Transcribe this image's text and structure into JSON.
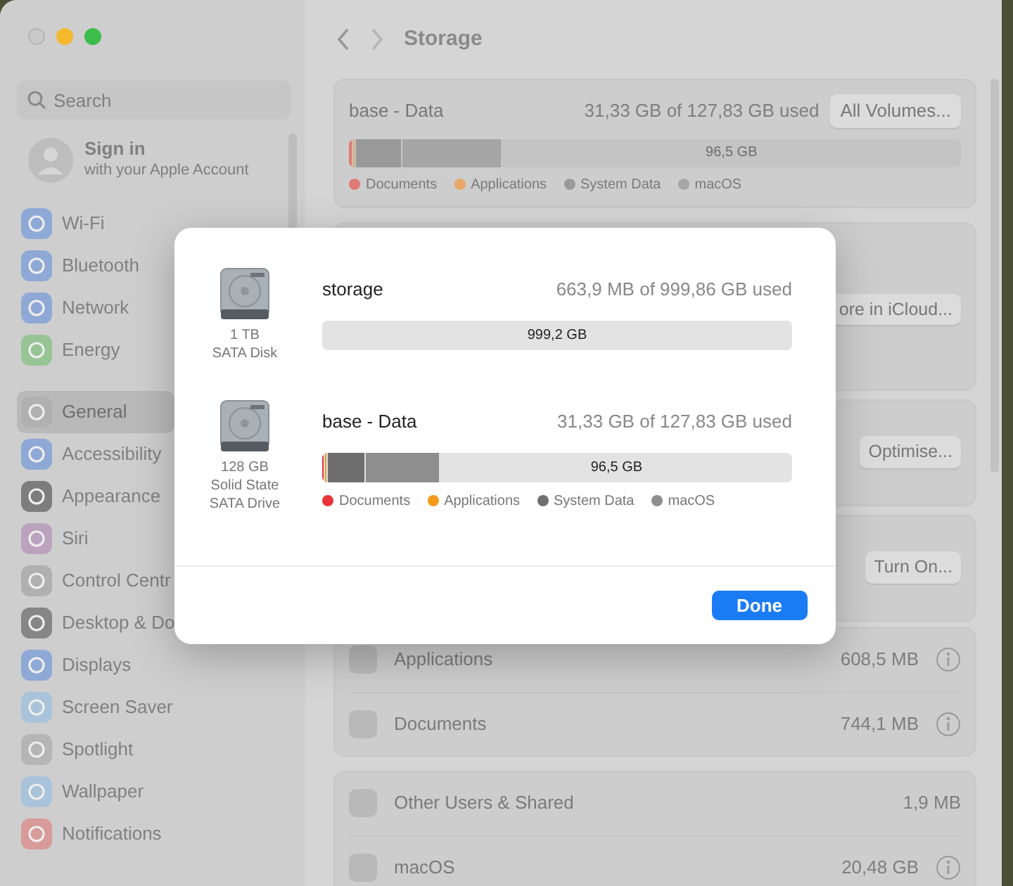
{
  "sidebar": {
    "search": {
      "placeholder": "Search"
    },
    "account": {
      "title": "Sign in",
      "subtitle": "with your Apple Account"
    },
    "sections": [
      {
        "items": [
          {
            "label": "Wi-Fi",
            "color": "#8fa9d6",
            "selected": false
          },
          {
            "label": "Bluetooth",
            "color": "#8fa9d6",
            "selected": false
          },
          {
            "label": "Network",
            "color": "#8fa9d6",
            "selected": false
          },
          {
            "label": "Energy",
            "color": "#97c495",
            "selected": false
          }
        ]
      },
      {
        "items": [
          {
            "label": "General",
            "color": "#b0b0b0",
            "selected": true
          },
          {
            "label": "Accessibility",
            "color": "#8fa9d6",
            "selected": false
          },
          {
            "label": "Appearance",
            "color": "#7d7d7d",
            "selected": false
          },
          {
            "label": "Siri",
            "color": "#bba3be",
            "selected": false
          },
          {
            "label": "Control Centr",
            "color": "#b0b0b0",
            "selected": false
          },
          {
            "label": "Desktop & Do",
            "color": "#868686",
            "selected": false
          },
          {
            "label": "Displays",
            "color": "#8fa9d6",
            "selected": false
          },
          {
            "label": "Screen Saver",
            "color": "#a9c3da",
            "selected": false
          },
          {
            "label": "Spotlight",
            "color": "#b5b5b5",
            "selected": false
          },
          {
            "label": "Wallpaper",
            "color": "#a9c3da",
            "selected": false
          },
          {
            "label": "Notifications",
            "color": "#d99a9a",
            "selected": false
          }
        ]
      }
    ]
  },
  "header": {
    "title": "Storage"
  },
  "summary": {
    "name": "base - Data",
    "usage": "31,33 GB of 127,83 GB used",
    "button": "All Volumes...",
    "bar": {
      "free_label": "96,5 GB",
      "segments": [
        {
          "color": "#e07a74",
          "level": 0.005
        },
        {
          "color": "#e8a868",
          "level": 0.003
        },
        {
          "color": "#9a9a9a",
          "level": 0.073
        },
        {
          "color": "#a6a6a6",
          "level": 0.16
        }
      ]
    },
    "legend": [
      {
        "label": "Documents",
        "color": "#e07a74"
      },
      {
        "label": "Applications",
        "color": "#e8a868"
      },
      {
        "label": "System Data",
        "color": "#9a9a9a"
      },
      {
        "label": "macOS",
        "color": "#a6a6a6"
      }
    ]
  },
  "recommendations": [
    {
      "button": "ore in iCloud..."
    },
    {
      "button": "Optimise..."
    },
    {
      "button": "Turn On..."
    }
  ],
  "categories": [
    [
      {
        "label": "Applications",
        "size": "608,5 MB",
        "info": true
      },
      {
        "label": "Documents",
        "size": "744,1 MB",
        "info": true
      }
    ],
    [
      {
        "label": "Other Users & Shared",
        "size": "1,9 MB",
        "info": false
      },
      {
        "label": "macOS",
        "size": "20,48 GB",
        "info": true
      }
    ]
  ],
  "dialog": {
    "disks": [
      {
        "name": "storage",
        "caption": [
          "1 TB",
          "SATA Disk"
        ],
        "usage": "663,9 MB of 999,86 GB used",
        "bar": {
          "free_label": "999,2 GB"
        }
      },
      {
        "name": "base - Data",
        "caption": [
          "128 GB",
          "Solid State",
          "SATA Drive"
        ],
        "usage": "31,33 GB of 127,83 GB used",
        "bar": {
          "free_label": "96,5 GB",
          "segments": [
            {
              "color": "#e8333a",
              "level": 0.004
            },
            {
              "color": "#f39a1b",
              "level": 0.003
            },
            {
              "color": "#6e6e6e",
              "level": 0.078
            },
            {
              "color": "#8e8e8e",
              "level": 0.156
            }
          ]
        },
        "legend": [
          {
            "label": "Documents",
            "color": "#e8333a"
          },
          {
            "label": "Applications",
            "color": "#f39a1b"
          },
          {
            "label": "System Data",
            "color": "#6e6e6e"
          },
          {
            "label": "macOS",
            "color": "#8e8e8e"
          }
        ]
      }
    ],
    "button": "Done"
  }
}
